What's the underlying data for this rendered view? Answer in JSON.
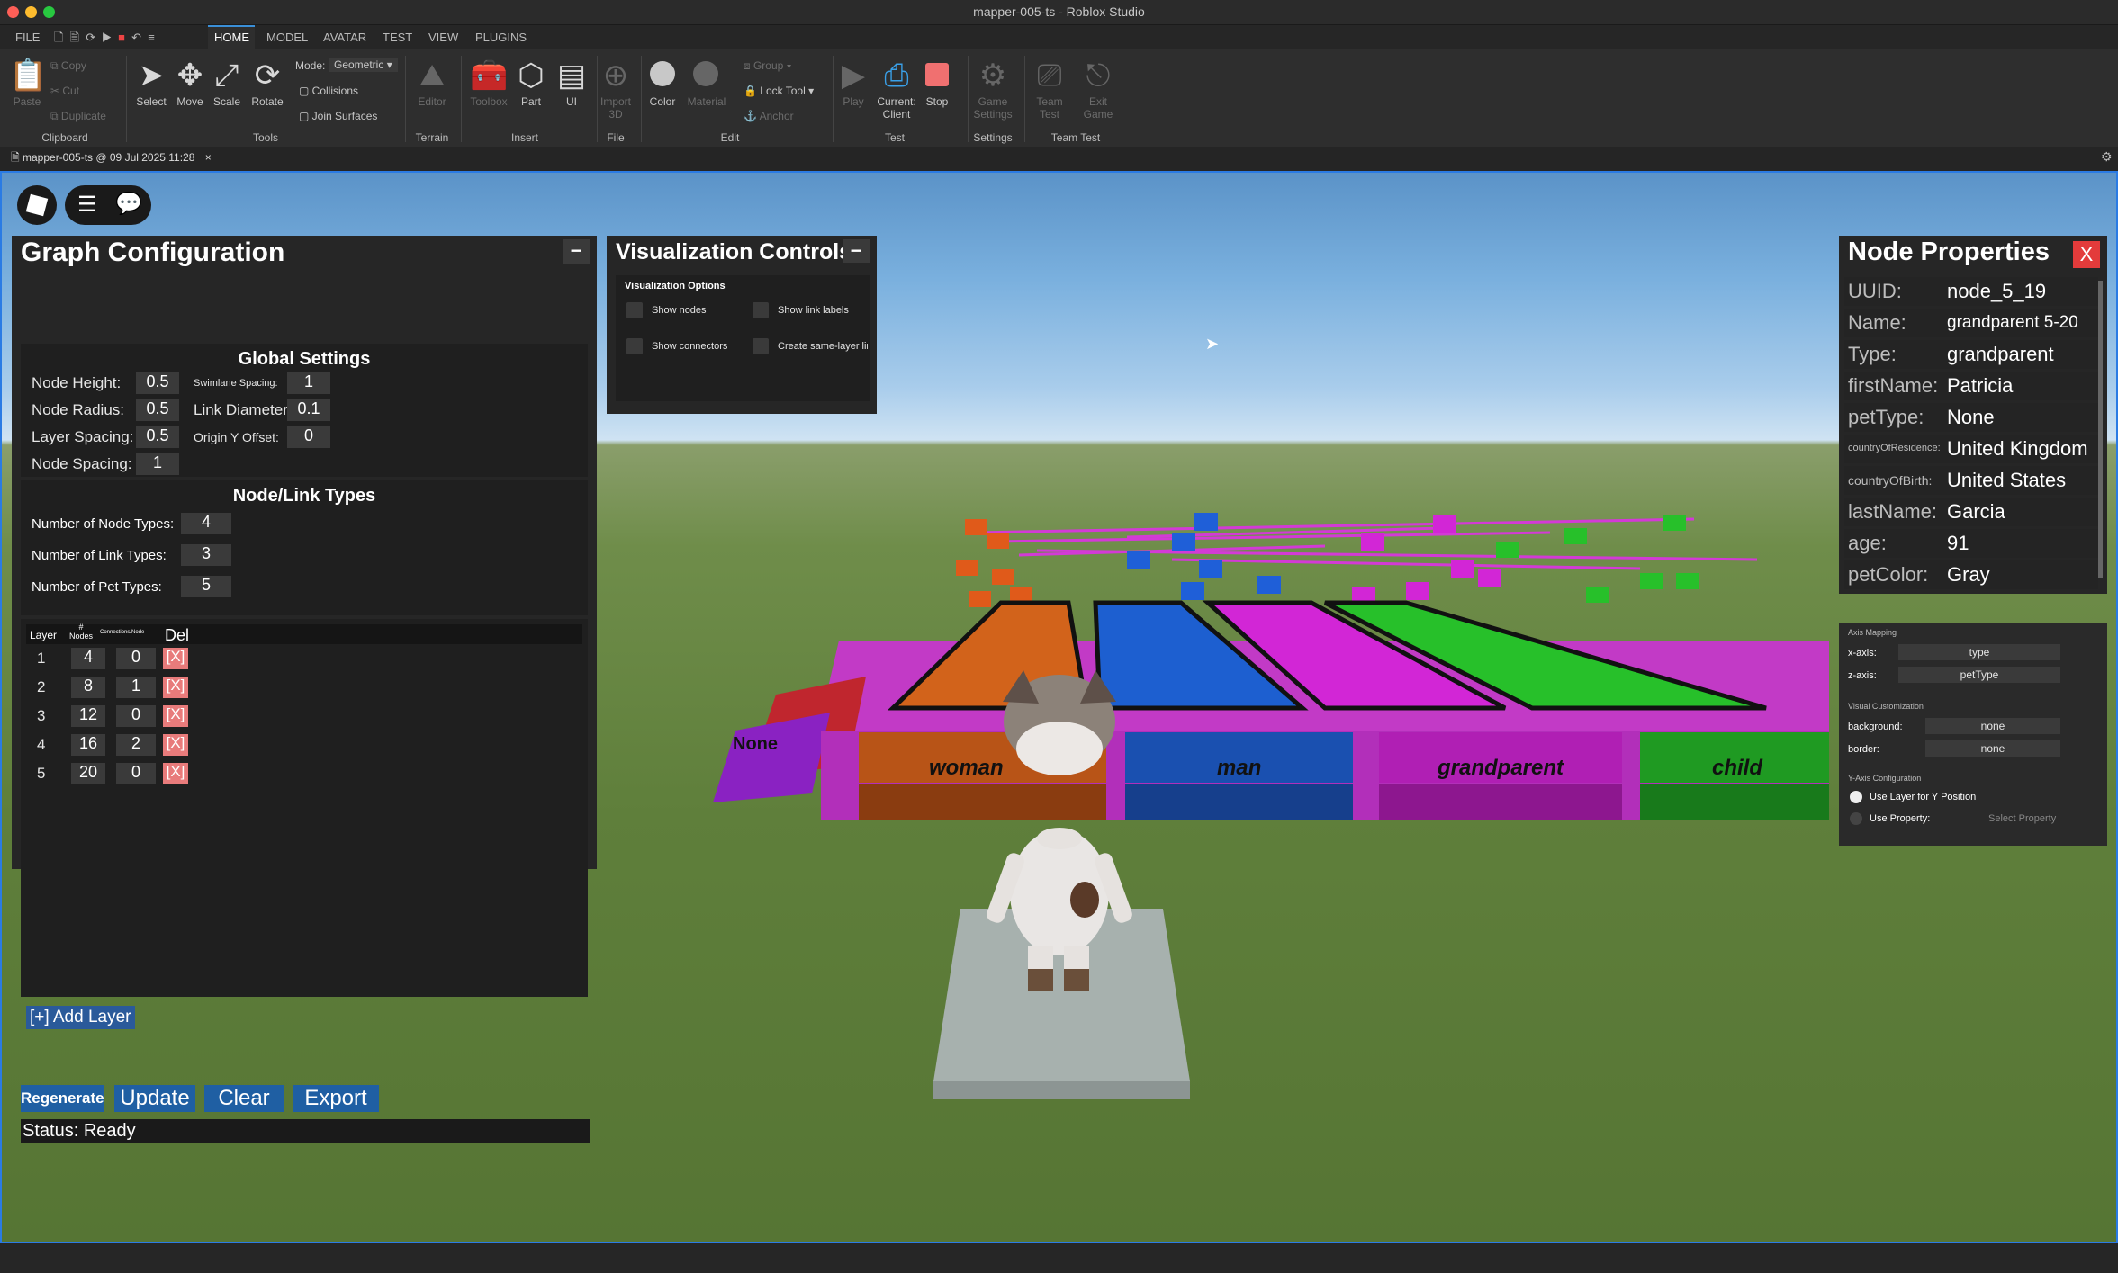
{
  "window": {
    "title": "mapper-005-ts - Roblox Studio"
  },
  "menu": {
    "items": [
      "FILE",
      "HOME",
      "MODEL",
      "AVATAR",
      "TEST",
      "VIEW",
      "PLUGINS"
    ]
  },
  "ribbon": {
    "clipboard": {
      "paste": "Paste",
      "copy": "Copy",
      "cut": "Cut",
      "duplicate": "Duplicate",
      "group": "Clipboard"
    },
    "tools": {
      "select": "Select",
      "move": "Move",
      "scale": "Scale",
      "rotate": "Rotate",
      "mode_label": "Mode:",
      "mode_value": "Geometric",
      "collisions": "Collisions",
      "join_surfaces": "Join Surfaces",
      "group": "Tools"
    },
    "terrain": {
      "editor": "Editor",
      "group": "Terrain"
    },
    "insert": {
      "toolbox": "Toolbox",
      "part": "Part",
      "ui": "UI",
      "group": "Insert"
    },
    "file": {
      "import": "Import",
      "import2": "3D",
      "group": "File"
    },
    "edit": {
      "color": "Color",
      "material": "Material",
      "group_btn": "Group",
      "lock_tool": "Lock Tool",
      "anchor": "Anchor",
      "group": "Edit"
    },
    "test": {
      "play": "Play",
      "current": "Current:",
      "client": "Client",
      "stop": "Stop",
      "group": "Test"
    },
    "settings": {
      "game": "Game",
      "settings": "Settings",
      "group": "Settings"
    },
    "teamtest": {
      "team": "Team",
      "test": "Test",
      "exit": "Exit",
      "game": "Game",
      "group": "Team Test"
    }
  },
  "doc_tab": {
    "label": "mapper-005-ts @ 09 Jul 2025 11:28",
    "close": "×"
  },
  "graph_config": {
    "title": "Graph Configuration",
    "minimize": "−",
    "global_title": "Global Settings",
    "settings": [
      {
        "label": "Node Height:",
        "value": "0.5"
      },
      {
        "label": "Node Radius:",
        "value": "0.5"
      },
      {
        "label": "Layer Spacing:",
        "value": "0.5"
      },
      {
        "label": "Node Spacing:",
        "value": "1"
      }
    ],
    "settings2": [
      {
        "label": "Swimlane Spacing:",
        "value": "1"
      },
      {
        "label": "Link Diameter:",
        "value": "0.1"
      },
      {
        "label": "Origin Y Offset:",
        "value": "0"
      }
    ],
    "types_title": "Node/Link Types",
    "types": [
      {
        "label": "Number of Node Types:",
        "value": "4"
      },
      {
        "label": "Number of Link Types:",
        "value": "3"
      },
      {
        "label": "Number of Pet Types:",
        "value": "5"
      }
    ],
    "layer_headers": {
      "layer": "Layer",
      "nodes": "# Nodes",
      "connections": "Connections/Node",
      "del": "Del"
    },
    "layers": [
      {
        "layer": "1",
        "nodes": "4",
        "conn": "0",
        "del": "[X]"
      },
      {
        "layer": "2",
        "nodes": "8",
        "conn": "1",
        "del": "[X]"
      },
      {
        "layer": "3",
        "nodes": "12",
        "conn": "0",
        "del": "[X]"
      },
      {
        "layer": "4",
        "nodes": "16",
        "conn": "2",
        "del": "[X]"
      },
      {
        "layer": "5",
        "nodes": "20",
        "conn": "0",
        "del": "[X]"
      }
    ],
    "add_layer": "[+] Add Layer",
    "buttons": {
      "regenerate": "Regenerate",
      "update": "Update",
      "clear": "Clear",
      "export": "Export"
    },
    "status": "Status: Ready"
  },
  "viz_controls": {
    "title": "Visualization Controls",
    "minimize": "−",
    "section": "Visualization Options",
    "options": {
      "show_nodes": "Show nodes",
      "show_link_labels": "Show link labels",
      "show_connectors": "Show connectors",
      "same_layer": "Create same-layer link"
    }
  },
  "node_props": {
    "title": "Node Properties",
    "close": "X",
    "rows": [
      {
        "key": "UUID:",
        "value": "node_5_19"
      },
      {
        "key": "Name:",
        "value": "grandparent 5-20"
      },
      {
        "key": "Type:",
        "value": "grandparent"
      },
      {
        "key": "firstName:",
        "value": "Patricia"
      },
      {
        "key": "petType:",
        "value": "None"
      },
      {
        "key": "countryOfResidence:",
        "value": "United Kingdom"
      },
      {
        "key": "countryOfBirth:",
        "value": "United States"
      },
      {
        "key": "lastName:",
        "value": "Garcia"
      },
      {
        "key": "age:",
        "value": "91"
      },
      {
        "key": "petColor:",
        "value": "Gray"
      }
    ]
  },
  "axis_panel": {
    "axis_mapping": "Axis Mapping",
    "x_label": "x-axis:",
    "x_value": "type",
    "z_label": "z-axis:",
    "z_value": "petType",
    "visual_custom": "Visual Customization",
    "bg_label": "background:",
    "bg_value": "none",
    "border_label": "border:",
    "border_value": "none",
    "y_config": "Y-Axis Configuration",
    "use_layer": "Use Layer for Y Position",
    "use_property": "Use Property:",
    "select_property": "Select Property"
  },
  "scene": {
    "front_labels": [
      "woman",
      "man",
      "grandparent",
      "child"
    ],
    "side_label": "None",
    "colors": {
      "woman": "#d2631b",
      "man": "#1d5fd0",
      "grandparent": "#d226d6",
      "child": "#27c02a",
      "none": "#8a22c2"
    }
  }
}
